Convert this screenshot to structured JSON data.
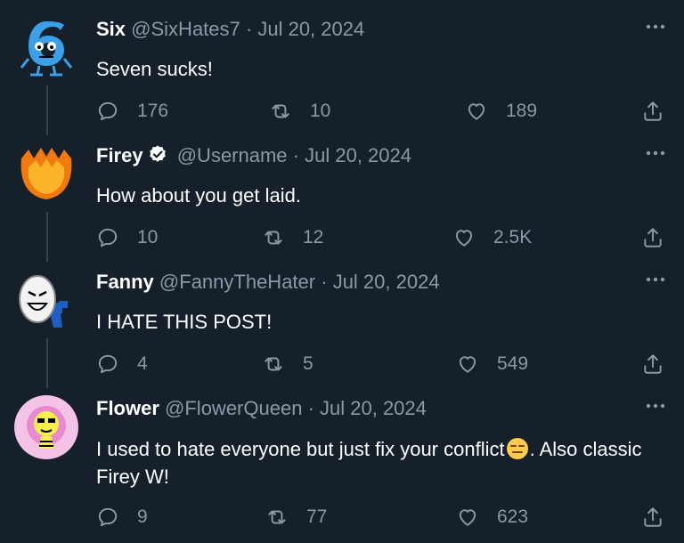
{
  "tweets": [
    {
      "name": "Six",
      "handle": "@SixHates7",
      "separator": "·",
      "date": "Jul 20, 2024",
      "verified": false,
      "text": "Seven sucks!",
      "text_after_emoji": "",
      "replies": "176",
      "retweets": "10",
      "likes": "189",
      "avatar_icon": "blue-six-character-avatar"
    },
    {
      "name": "Firey",
      "handle": "@Username",
      "separator": "·",
      "date": "Jul 20, 2024",
      "verified": true,
      "text": "How about you get laid.",
      "text_after_emoji": "",
      "replies": "10",
      "retweets": "12",
      "likes": "2.5K",
      "avatar_icon": "flame-avatar"
    },
    {
      "name": "Fanny",
      "handle": "@FannyTheHater",
      "separator": "·",
      "date": "Jul 20, 2024",
      "verified": false,
      "text": "I HATE THIS POST!",
      "text_after_emoji": "",
      "replies": "4",
      "retweets": "5",
      "likes": "549",
      "avatar_icon": "fan-character-avatar"
    },
    {
      "name": "Flower",
      "handle": "@FlowerQueen",
      "separator": "·",
      "date": "Jul 20, 2024",
      "verified": false,
      "text": "I used to hate everyone but just fix your conflict",
      "text_after_emoji": ". Also classic Firey W!",
      "emoji": "expressionless-face-emoji",
      "replies": "9",
      "retweets": "77",
      "likes": "623",
      "avatar_icon": "flower-character-avatar"
    }
  ],
  "colors": {
    "background": "#15202b",
    "muted": "#8b98a5",
    "thread_line": "#38444d"
  }
}
